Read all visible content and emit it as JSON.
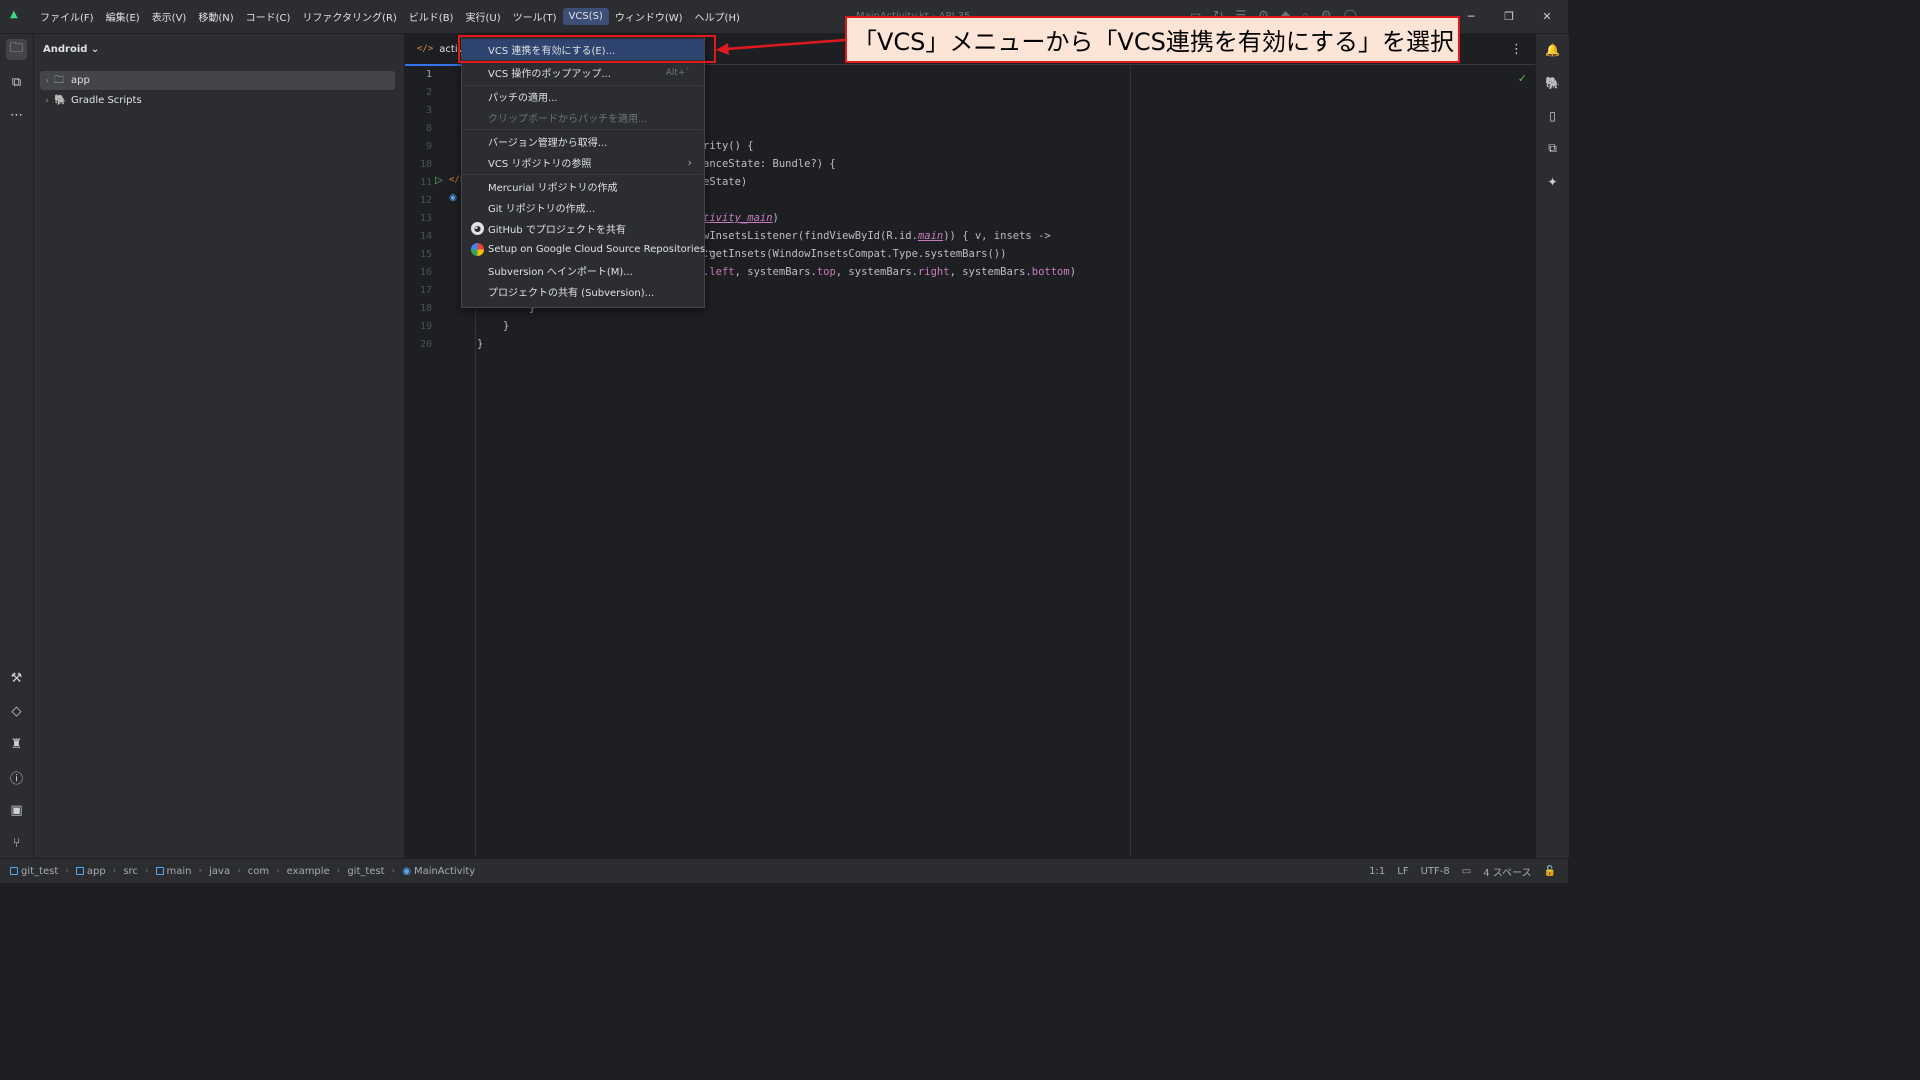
{
  "menubar": {
    "items": [
      "ファイル(F)",
      "編集(E)",
      "表示(V)",
      "移動(N)",
      "コード(C)",
      "リファクタリング(R)",
      "ビルド(B)",
      "実行(U)",
      "ツール(T)",
      "VCS(S)",
      "ウィンドウ(W)",
      "ヘルプ(H)"
    ],
    "active": "VCS(S)"
  },
  "title_faint": "MainActivity.kt - API 35",
  "window_controls": {
    "minimize": "─",
    "restore": "❐",
    "close": "✕"
  },
  "project": {
    "view_selector": "Android",
    "tree": [
      {
        "label": "app",
        "selected": true
      },
      {
        "label": "Gradle Scripts",
        "selected": false
      }
    ]
  },
  "editor": {
    "tab_label": "activit",
    "line_numbers": [
      "1",
      "2",
      "3",
      "8",
      "9",
      "10",
      "11",
      "12",
      "13",
      "14",
      "15",
      "16",
      "17",
      "18",
      "19",
      "20"
    ],
    "current_line": "1",
    "code": {
      "l9": "rity() {",
      "l10": "anceState: Bundle?) {",
      "l11": "eState)",
      "l13_field": "tivity_main",
      "l13_tail": ")",
      "l14_pre": "wInsetsListener(findViewById(R.id.",
      "l14_field": "main",
      "l14_post": ")) { v, insets ->",
      "l15": ".getInsets(WindowInsetsCompat.Type.systemBars())",
      "l16_a": ".",
      "l16_f1": "left",
      "l16_b": ", systemBars.",
      "l16_f2": "top",
      "l16_c": ", systemBars.",
      "l16_f3": "right",
      "l16_d": ", systemBars.",
      "l16_f4": "bottom",
      "l16_e": ")",
      "l18": "}",
      "l19": "}",
      "l20": "}"
    }
  },
  "vcs_menu": {
    "items": [
      {
        "label": "VCS 連携を有効にする(E)...",
        "shortcut": "",
        "submenu": false,
        "disabled": false,
        "icon": ""
      },
      {
        "label": "VCS 操作のポップアップ...",
        "shortcut": "Alt+`",
        "submenu": false,
        "disabled": false,
        "icon": ""
      },
      {
        "label": "パッチの適用...",
        "shortcut": "",
        "submenu": false,
        "disabled": false,
        "icon": ""
      },
      {
        "label": "クリップボードからパッチを適用...",
        "shortcut": "",
        "submenu": false,
        "disabled": true,
        "icon": ""
      },
      {
        "label": "バージョン管理から取得...",
        "shortcut": "",
        "submenu": false,
        "disabled": false,
        "icon": ""
      },
      {
        "label": "VCS リポジトリの参照",
        "shortcut": "",
        "submenu": true,
        "disabled": false,
        "icon": ""
      },
      {
        "label": "Mercurial リポジトリの作成",
        "shortcut": "",
        "submenu": false,
        "disabled": false,
        "icon": ""
      },
      {
        "label": "Git リポジトリの作成...",
        "shortcut": "",
        "submenu": false,
        "disabled": false,
        "icon": ""
      },
      {
        "label": "GitHub でプロジェクトを共有",
        "shortcut": "",
        "submenu": false,
        "disabled": false,
        "icon": "github-icon"
      },
      {
        "label": "Setup on Google Cloud Source Repositories...",
        "shortcut": "",
        "submenu": false,
        "disabled": false,
        "icon": "google-cloud-icon"
      },
      {
        "label": "Subversion へインポート(M)...",
        "shortcut": "",
        "submenu": false,
        "disabled": false,
        "icon": ""
      },
      {
        "label": "プロジェクトの共有 (Subversion)...",
        "shortcut": "",
        "submenu": false,
        "disabled": false,
        "icon": ""
      }
    ]
  },
  "annotation": {
    "callout_text": "「VCS」メニューから「VCS連携を有効にする」を選択",
    "highlight_color": "#e0191f",
    "callout_background": "#fce4d6"
  },
  "statusbar": {
    "breadcrumbs": [
      "git_test",
      "app",
      "src",
      "main",
      "java",
      "com",
      "example",
      "git_test",
      "MainActivity"
    ],
    "position": "1:1",
    "line_ending": "LF",
    "encoding": "UTF-8",
    "indent": "4 スペース"
  },
  "colors": {
    "accent": "#3574f0",
    "background": "#1e1f22",
    "panel": "#2b2d30",
    "success": "#5fb865"
  }
}
